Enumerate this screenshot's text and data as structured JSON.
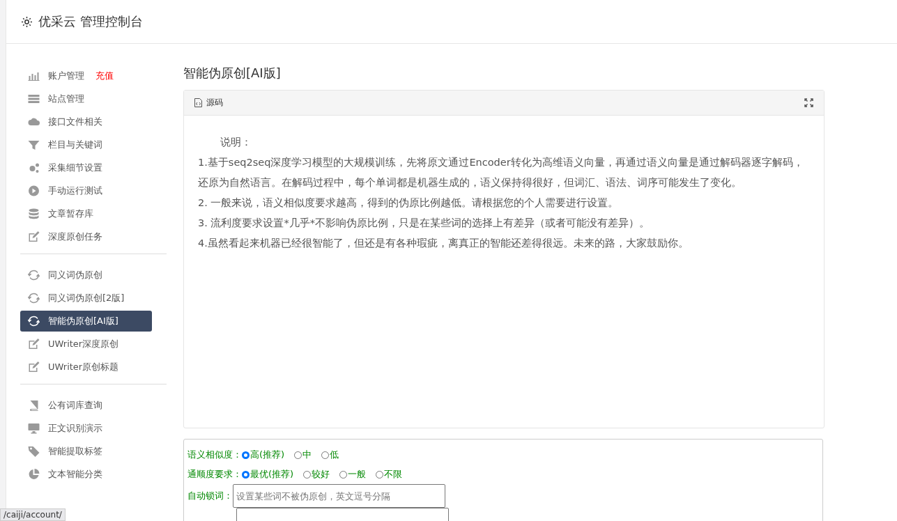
{
  "header": {
    "title": "优采云 管理控制台"
  },
  "sidebar": {
    "groups": [
      {
        "items": [
          {
            "label": "账户管理",
            "badge": "充值",
            "selected": false
          },
          {
            "label": "站点管理",
            "selected": false
          },
          {
            "label": "接口文件相关",
            "selected": false
          },
          {
            "label": "栏目与关键词",
            "selected": false
          },
          {
            "label": "采集细节设置",
            "selected": false
          },
          {
            "label": "手动运行测试",
            "selected": false
          },
          {
            "label": "文章暂存库",
            "selected": false
          },
          {
            "label": "深度原创任务",
            "selected": false
          }
        ]
      },
      {
        "items": [
          {
            "label": "同义词伪原创",
            "selected": false
          },
          {
            "label": "同义词伪原创[2版]",
            "selected": false
          },
          {
            "label": "智能伪原创[AI版]",
            "selected": true
          },
          {
            "label": "UWriter深度原创",
            "selected": false
          },
          {
            "label": "UWriter原创标题",
            "selected": false
          }
        ]
      },
      {
        "items": [
          {
            "label": "公有词库查询",
            "selected": false
          },
          {
            "label": "正文识别演示",
            "selected": false
          },
          {
            "label": "智能提取标签",
            "selected": false
          },
          {
            "label": "文本智能分类",
            "selected": false
          }
        ]
      }
    ]
  },
  "content": {
    "title": "智能伪原创[AI版]",
    "panel": {
      "header_label": "源码",
      "paragraphs": [
        "说明：",
        "1.基于seq2seq深度学习模型的大规模训练，先将原文通过Encoder转化为高维语义向量，再通过语义向量是通过解码器逐字解码，还原为自然语言。在解码过程中，每个单词都是机器生成的，语义保持得很好，但词汇、语法、词序可能发生了变化。",
        "2. 一般来说，语义相似度要求越高，得到的伪原比例越低。请根据您的个人需要进行设置。",
        "3. 流利度要求设置*几乎*不影响伪原比例，只是在某些词的选择上有差异（或者可能没有差异）。",
        "4.虽然看起来机器已经很智能了，但还是有各种瑕疵，离真正的智能还差得很远。未来的路，大家鼓励你。"
      ]
    },
    "form": {
      "rows": [
        {
          "kind": "radio",
          "label": "语义相似度：",
          "options": [
            {
              "label": "高(推荐)",
              "selected": true
            },
            {
              "label": "中",
              "selected": false
            },
            {
              "label": "低",
              "selected": false
            }
          ]
        },
        {
          "kind": "radio",
          "label": "通顺度要求：",
          "options": [
            {
              "label": "最优(推荐)",
              "selected": true
            },
            {
              "label": "较好",
              "selected": false
            },
            {
              "label": "一般",
              "selected": false
            },
            {
              "label": "不限",
              "selected": false
            }
          ]
        },
        {
          "kind": "text",
          "label": "自动锁词：",
          "placeholder": "设置某些词不被伪原创，英文逗号分隔"
        },
        {
          "kind": "text"
        }
      ]
    }
  },
  "status_url": "/caiji/account/"
}
